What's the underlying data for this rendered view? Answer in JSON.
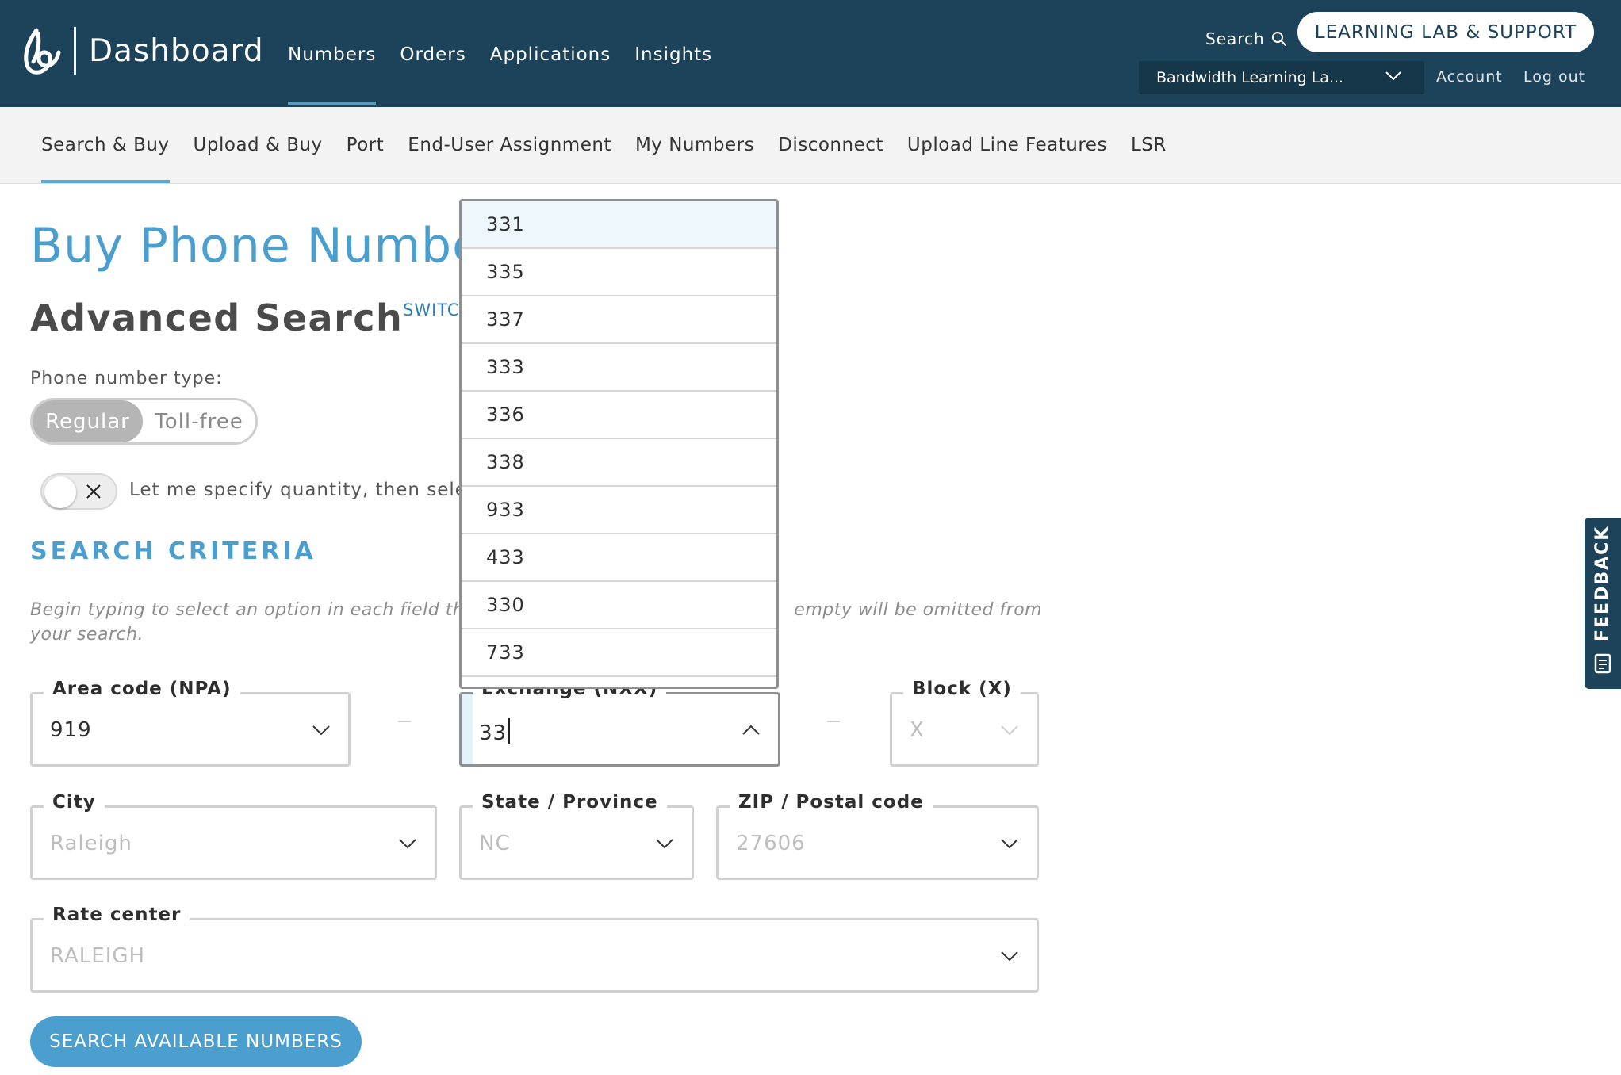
{
  "header": {
    "app_title": "Dashboard",
    "nav": [
      {
        "label": "Numbers",
        "active": true
      },
      {
        "label": "Orders"
      },
      {
        "label": "Applications"
      },
      {
        "label": "Insights"
      }
    ],
    "search_label": "Search",
    "support_button": "LEARNING LAB & SUPPORT",
    "account_selector": "Bandwidth Learning La...",
    "account_link": "Account",
    "logout_link": "Log out"
  },
  "subnav": [
    {
      "label": "Search & Buy",
      "active": true
    },
    {
      "label": "Upload & Buy"
    },
    {
      "label": "Port"
    },
    {
      "label": "End-User Assignment"
    },
    {
      "label": "My Numbers"
    },
    {
      "label": "Disconnect"
    },
    {
      "label": "Upload Line Features"
    },
    {
      "label": "LSR"
    }
  ],
  "page": {
    "title": "Buy Phone Number",
    "section_title": "Advanced Search",
    "switch_link": "SWITC",
    "phone_type_label": "Phone number type:",
    "phone_type_options": {
      "selected": "Regular",
      "other": "Toll-free"
    },
    "quantity_toggle_label": "Let me specify quantity, then select",
    "quantity_toggle_on": false,
    "criteria_heading": "SEARCH CRITERIA",
    "criteria_help_part1": "Begin typing to select an option in each field tha",
    "criteria_help_part2": "empty will be omitted from",
    "criteria_help_line2": "your search.",
    "search_button": "SEARCH AVAILABLE NUMBERS"
  },
  "fields": {
    "area_code": {
      "label": "Area code (NPA)",
      "value": "919"
    },
    "exchange": {
      "label": "Exchange (NXX)",
      "value": "33"
    },
    "block": {
      "label": "Block (X)",
      "placeholder": "X"
    },
    "city": {
      "label": "City",
      "placeholder": "Raleigh"
    },
    "state": {
      "label": "State / Province",
      "placeholder": "NC"
    },
    "zip": {
      "label": "ZIP / Postal code",
      "placeholder": "27606"
    },
    "rate_center": {
      "label": "Rate center",
      "placeholder": "RALEIGH"
    }
  },
  "exchange_options": [
    "331",
    "335",
    "337",
    "333",
    "336",
    "338",
    "933",
    "433",
    "330",
    "733"
  ],
  "feedback_tab": "FEEDBACK",
  "colors": {
    "header_bg": "#1c4359",
    "accent": "#4a9fcf",
    "subnav_bg": "#f3f3f3"
  }
}
